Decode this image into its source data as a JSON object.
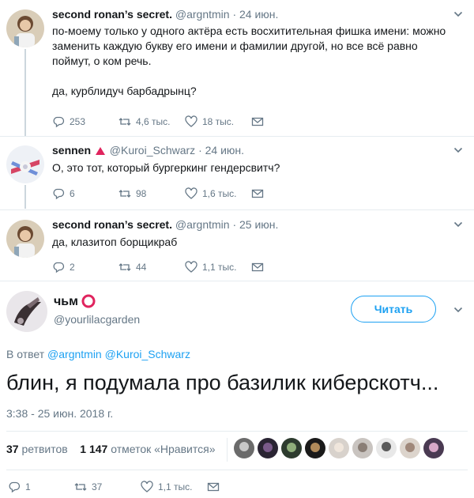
{
  "tweets": [
    {
      "name": "second ronan’s secret.",
      "handle": "@argntmin",
      "dot": "·",
      "date": "24 июн.",
      "lines": [
        "по-моему только у одного актёра есть восхитительная фишка имени: можно",
        "заменить каждую букву его имени и фамилии другой, но все всё равно",
        "поймут, о ком речь.",
        "",
        "да, курблидуч барбадрынц?"
      ],
      "replies": "253",
      "retweets": "4,6 тыс.",
      "likes": "18 тыс."
    },
    {
      "name": "sennen",
      "handle": "@Kuroi_Schwarz",
      "dot": "·",
      "date": "24 июн.",
      "lines": [
        "О, это тот, который бургеркинг гендерсвитч?"
      ],
      "replies": "6",
      "retweets": "98",
      "likes": "1,6 тыс."
    },
    {
      "name": "second ronan’s secret.",
      "handle": "@argntmin",
      "dot": "·",
      "date": "25 июн.",
      "lines": [
        "да, клазитоп борщикраб"
      ],
      "replies": "2",
      "retweets": "44",
      "likes": "1,1 тыс."
    }
  ],
  "main": {
    "name": "чьм",
    "handle": "@yourlilacgarden",
    "follow_label": "Читать",
    "reply_prefix": "В ответ",
    "reply_users": "@argntmin @Kuroi_Schwarz",
    "text": "блин, я подумала про базилик киберскотч...",
    "timestamp": "3:38 - 25 июн. 2018 г.",
    "retweets_count": "37",
    "retweets_label": "ретвитов",
    "likes_count": "1 147",
    "likes_label": "отметок «Нравится»",
    "replies": "1",
    "retweets": "37",
    "likes": "1,1 тыс."
  },
  "icons": {
    "reply": "reply-icon",
    "retweet": "retweet-icon",
    "like": "heart-icon",
    "dm": "envelope-icon",
    "menu": "chevron-down-icon",
    "badge": "red-triangle-icon",
    "emoji": "red-circle-icon"
  },
  "colors": {
    "accent": "#1da1f2",
    "muted": "#657786",
    "text": "#14171a",
    "badge_red": "#e0245e",
    "border": "#e6ecf0"
  }
}
